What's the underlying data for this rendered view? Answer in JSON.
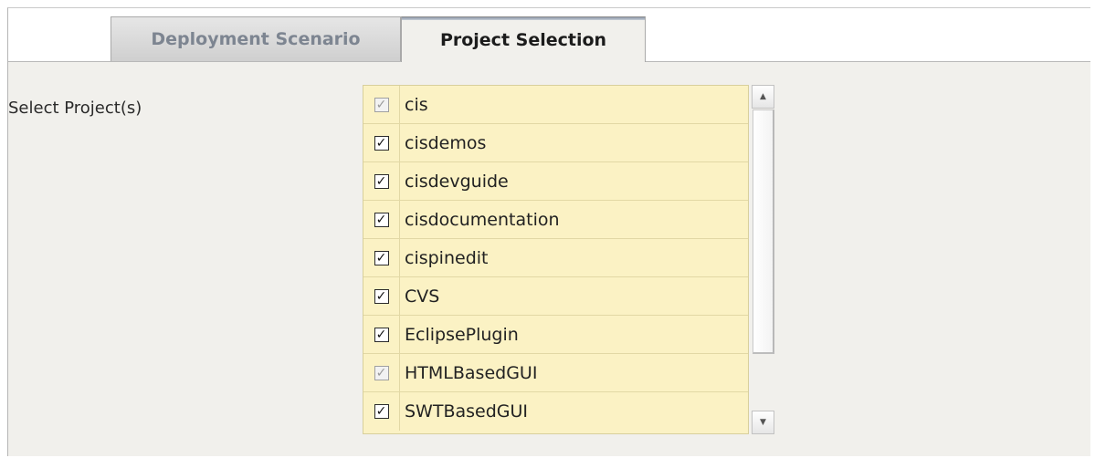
{
  "tabs": [
    {
      "label": "Deployment Scenario",
      "active": false
    },
    {
      "label": "Project Selection",
      "active": true
    }
  ],
  "form": {
    "select_label": "Select Project(s)"
  },
  "projects": [
    {
      "label": "cis",
      "checked": true,
      "disabled": true
    },
    {
      "label": "cisdemos",
      "checked": true,
      "disabled": false
    },
    {
      "label": "cisdevguide",
      "checked": true,
      "disabled": false
    },
    {
      "label": "cisdocumentation",
      "checked": true,
      "disabled": false
    },
    {
      "label": "cispinedit",
      "checked": true,
      "disabled": false
    },
    {
      "label": "CVS",
      "checked": true,
      "disabled": false
    },
    {
      "label": "EclipsePlugin",
      "checked": true,
      "disabled": false
    },
    {
      "label": "HTMLBasedGUI",
      "checked": true,
      "disabled": true
    },
    {
      "label": "SWTBasedGUI",
      "checked": true,
      "disabled": false
    }
  ],
  "icons": {
    "check": "✓",
    "scroll_up": "▲",
    "scroll_down": "▼"
  },
  "colors": {
    "list_background": "#fbf2c4",
    "panel_background": "#f1f0ec"
  }
}
